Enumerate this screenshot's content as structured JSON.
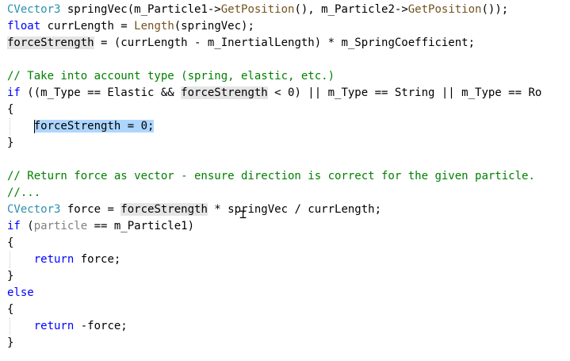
{
  "editor": {
    "language": "C++",
    "theme": {
      "background": "#ffffff",
      "selection": "#ADD6FF",
      "reference_highlight": "#E5E5E5"
    },
    "lines": [
      [
        {
          "t": "CVector3",
          "c": "type"
        },
        {
          "t": " springVec(m_Particle1->"
        },
        {
          "t": "GetPosition",
          "c": "fn"
        },
        {
          "t": "(), m_Particle2->"
        },
        {
          "t": "GetPosition",
          "c": "fn"
        },
        {
          "t": "());"
        }
      ],
      [
        {
          "t": "float",
          "c": "kw"
        },
        {
          "t": " currLength = "
        },
        {
          "t": "Length",
          "c": "fn"
        },
        {
          "t": "(springVec);"
        }
      ],
      [
        {
          "t": "forceStrength",
          "c": "hl"
        },
        {
          "t": " = (currLength - m_InertialLength) * m_SpringCoefficient;"
        }
      ],
      [],
      [
        {
          "t": "// Take into account type (spring, elastic, etc.)",
          "c": "comment"
        }
      ],
      [
        {
          "t": "if",
          "c": "kw"
        },
        {
          "t": " ((m_Type == Elastic && "
        },
        {
          "t": "forceStrength",
          "c": "hl"
        },
        {
          "t": " < 0) || m_Type == String || m_Type == Ro"
        }
      ],
      [
        {
          "t": "{"
        }
      ],
      [
        {
          "t": "    "
        },
        {
          "t": "forceStrength = 0;",
          "c": "sel"
        }
      ],
      [
        {
          "t": "}"
        }
      ],
      [],
      [
        {
          "t": "// Return force as vector - ensure direction is correct for the given particle.",
          "c": "comment"
        }
      ],
      [
        {
          "t": "//...",
          "c": "comment"
        }
      ],
      [
        {
          "t": "CVector3",
          "c": "type"
        },
        {
          "t": " force = "
        },
        {
          "t": "forceStrength",
          "c": "hl"
        },
        {
          "t": " * springVec / currLength;"
        }
      ],
      [
        {
          "t": "if",
          "c": "kw"
        },
        {
          "t": " ("
        },
        {
          "t": "particle",
          "c": "param"
        },
        {
          "t": " == m_Particle1)"
        }
      ],
      [
        {
          "t": "{"
        }
      ],
      [
        {
          "t": "    "
        },
        {
          "t": "return",
          "c": "kw"
        },
        {
          "t": " force;"
        }
      ],
      [
        {
          "t": "}"
        }
      ],
      [
        {
          "t": "else",
          "c": "kw"
        }
      ],
      [
        {
          "t": "{"
        }
      ],
      [
        {
          "t": "    "
        },
        {
          "t": "return",
          "c": "kw"
        },
        {
          "t": " -force;"
        }
      ],
      [
        {
          "t": "}"
        }
      ]
    ]
  }
}
